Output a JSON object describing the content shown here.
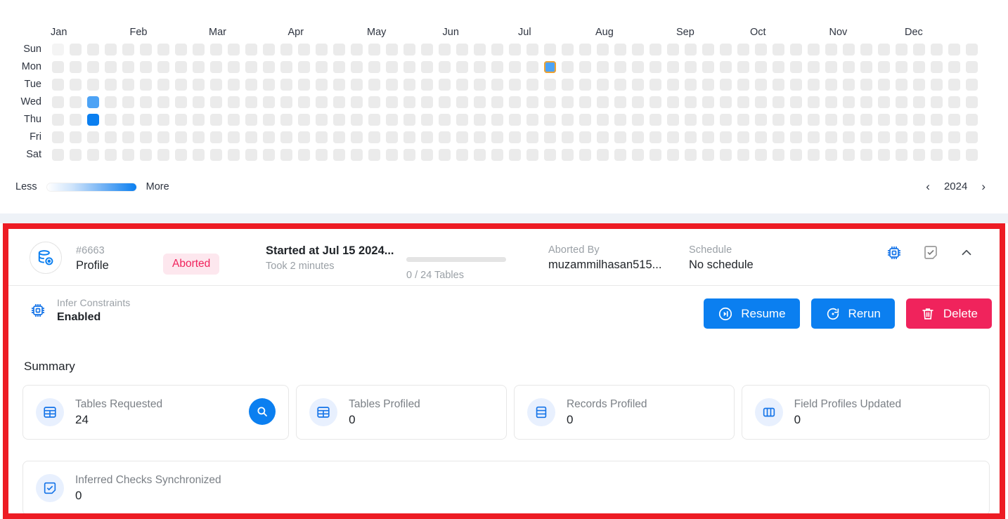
{
  "heatmap": {
    "months": [
      "Jan",
      "Feb",
      "Mar",
      "Apr",
      "May",
      "Jun",
      "Jul",
      "Aug",
      "Sep",
      "Oct",
      "Nov",
      "Dec"
    ],
    "days": [
      "Sun",
      "Mon",
      "Tue",
      "Wed",
      "Thu",
      "Fri",
      "Sat"
    ],
    "legend": {
      "less": "Less",
      "more": "More"
    },
    "year": "2024",
    "prev_icon": "chevron-left-icon",
    "next_icon": "chevron-right-icon",
    "colors": {
      "empty": "#ebebeb",
      "low": "#4da3f5",
      "high": "#0b7ff0",
      "selection_outline": "#f0a332"
    },
    "active_cells": [
      {
        "week": 2,
        "day": 3,
        "level": "low"
      },
      {
        "week": 2,
        "day": 4,
        "level": "high"
      },
      {
        "week": 28,
        "day": 1,
        "level": "low",
        "selected": true
      }
    ],
    "weeks": 53
  },
  "run": {
    "icon": "database-profile-icon",
    "id": "#6663",
    "name": "Profile",
    "status": "Aborted",
    "started": "Started at Jul 15 2024...",
    "duration": "Took 2 minutes",
    "progress_label": "0 / 24 Tables",
    "progress_percent": 0,
    "aborted_by_label": "Aborted By",
    "aborted_by_value": "muzammilhasan515...",
    "schedule_label": "Schedule",
    "schedule_value": "No schedule",
    "header_icons": [
      {
        "name": "chip-icon"
      },
      {
        "name": "checked-note-icon"
      },
      {
        "name": "chevron-up-icon"
      }
    ],
    "infer": {
      "icon": "chip-icon",
      "label": "Infer Constraints",
      "value": "Enabled"
    },
    "buttons": [
      {
        "name": "resume-button",
        "label": "Resume",
        "icon": "play-circle-icon",
        "color": "#0b7ff0"
      },
      {
        "name": "rerun-button",
        "label": "Rerun",
        "icon": "rerun-icon",
        "color": "#0b7ff0"
      },
      {
        "name": "delete-button",
        "label": "Delete",
        "icon": "trash-icon",
        "color": "#f0235c"
      }
    ],
    "summary_title": "Summary",
    "cards": [
      {
        "label": "Tables Requested",
        "value": "24",
        "icon": "table-grid-icon",
        "action": "search-icon"
      },
      {
        "label": "Tables Profiled",
        "value": "0",
        "icon": "table-grid-icon"
      },
      {
        "label": "Records Profiled",
        "value": "0",
        "icon": "records-rows-icon"
      },
      {
        "label": "Field Profiles Updated",
        "value": "0",
        "icon": "columns-icon"
      },
      {
        "label": "Inferred Checks Synchronized",
        "value": "0",
        "icon": "checked-note-icon"
      }
    ]
  }
}
